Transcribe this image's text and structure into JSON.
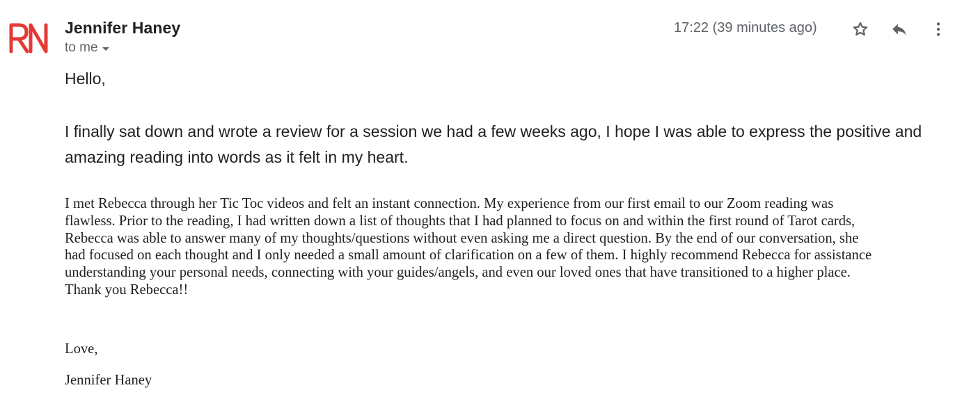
{
  "header": {
    "sender_name": "Jennifer Haney",
    "recipient_label": "to me",
    "timestamp": "17:22 (39 minutes ago)",
    "avatar_icon": "rn-logo-icon",
    "brand_color": "#e53935"
  },
  "actions": {
    "star_icon": "star-icon",
    "reply_icon": "reply-icon",
    "more_icon": "more-vert-icon"
  },
  "body": {
    "greeting": "Hello,",
    "intro": "I finally sat down and wrote a review for a session we had a few weeks ago, I hope I was able to express the positive and amazing reading into words as it felt in my heart.",
    "review_lines": [
      "I met Rebecca through her Tic Toc videos and felt an instant connection. My experience from our first email to our Zoom reading was",
      "flawless. Prior to the reading, I had written down a list of thoughts that I had planned to focus on and within the first round of Tarot cards,",
      "Rebecca was able to answer many of my thoughts/questions without even asking me a direct question. By the end of our conversation, she",
      "had focused on each thought and I only needed a small amount of clarification on a few of them. I highly recommend Rebecca for assistance",
      "understanding your personal needs, connecting with your guides/angels, and even our loved ones that have transitioned to a higher place.",
      "Thank you Rebecca!!"
    ],
    "signoff": "Love,",
    "signature": "Jennifer Haney"
  }
}
